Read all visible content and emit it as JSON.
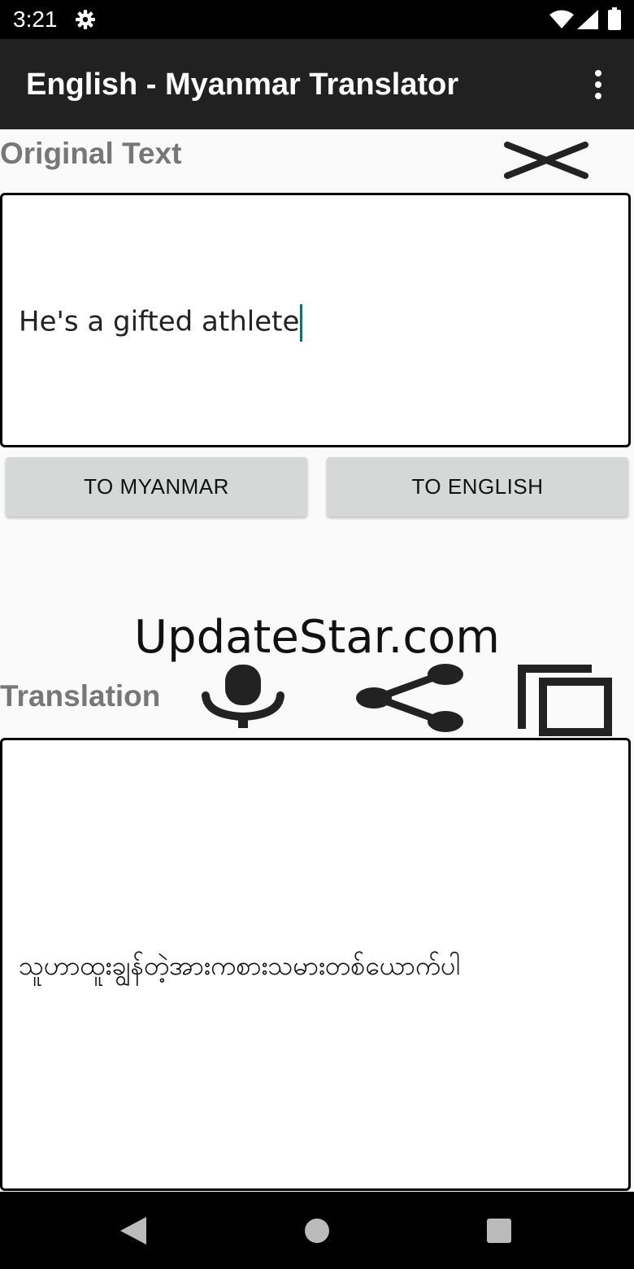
{
  "status_bar": {
    "time": "3:21",
    "icons": [
      "gear-icon",
      "wifi-icon",
      "signal-icon",
      "battery-icon"
    ]
  },
  "app_bar": {
    "title": "English - Myanmar Translator",
    "menu_icon": "more-vert-icon"
  },
  "original": {
    "label": "Original Text",
    "text": "He's a gifted athlete",
    "clear_icon": "close-icon"
  },
  "buttons": {
    "to_myanmar": "TO MYANMAR",
    "to_english": "TO ENGLISH"
  },
  "watermark": "UpdateStar.com",
  "translation": {
    "label": "Translation",
    "text": "သူဟာထူးချွန်တဲ့အားကစားသမားတစ်ယောက်ပါ",
    "icons": [
      "microphone-icon",
      "share-icon",
      "copy-icon"
    ]
  },
  "nav_bar": {
    "icons": [
      "back-icon",
      "home-icon",
      "recents-icon"
    ]
  },
  "colors": {
    "app_bar": "#212121",
    "label_gray": "#777777",
    "button_gray": "#d6d7d7",
    "cursor_teal": "#00796b"
  }
}
